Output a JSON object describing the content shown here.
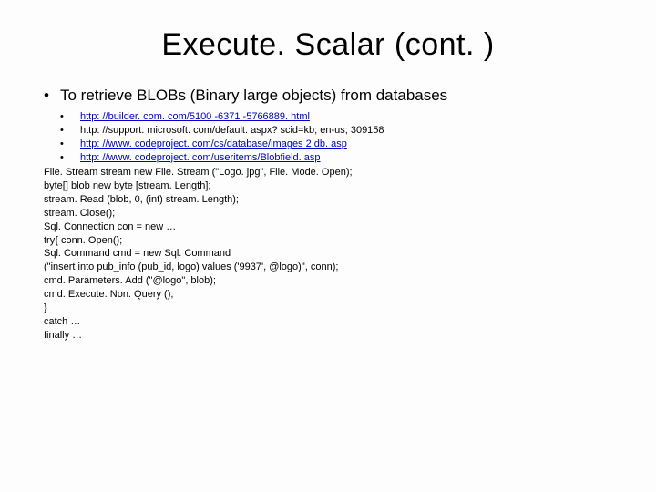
{
  "title": "Execute. Scalar (cont. )",
  "main_bullet": "To retrieve BLOBs (Binary large objects) from databases",
  "links": {
    "l1": "http: //builder. com. com/5100 -6371 -5766889. html",
    "l2": "http: //support. microsoft. com/default. aspx? scid=kb; en-us; 309158",
    "l3": "http: //www. codeproject. com/cs/database/images 2 db. asp",
    "l4": "http: //www. codeproject. com/useritems/Blobfield. asp"
  },
  "code": {
    "c01": "File. Stream stream new File. Stream (\"Logo. jpg\", File. Mode. Open);",
    "c02": "byte[] blob new byte [stream. Length];",
    "c03": "stream. Read (blob, 0, (int) stream. Length);",
    "c04": "stream. Close();",
    "c05": "Sql. Connection con = new …",
    "c06": "try{ conn. Open();",
    "c07": "Sql. Command cmd = new Sql. Command",
    "c08": "(\"insert into pub_info (pub_id, logo) values ('9937', @logo)\", conn);",
    "c09": "cmd. Parameters. Add (\"@logo\", blob);",
    "c10": "cmd. Execute. Non. Query ();",
    "c11": "}",
    "c12": "catch …",
    "c13": "finally …"
  }
}
